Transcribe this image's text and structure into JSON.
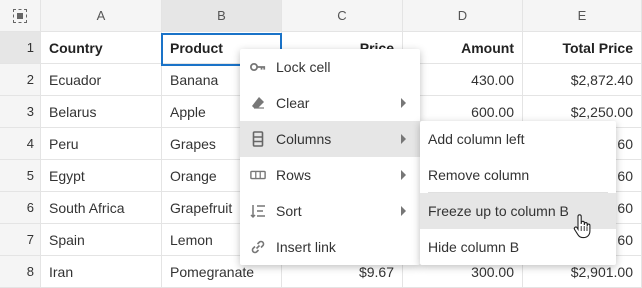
{
  "columns": [
    "A",
    "B",
    "C",
    "D",
    "E"
  ],
  "rows": [
    {
      "n": "1",
      "a": "Country",
      "b": "Product",
      "c": "Price",
      "d": "Amount",
      "e": "Total Price"
    },
    {
      "n": "2",
      "a": "Ecuador",
      "b": "Banana",
      "c": "",
      "d": "430.00",
      "e": "$2,872.40"
    },
    {
      "n": "3",
      "a": "Belarus",
      "b": "Apple",
      "c": "",
      "d": "600.00",
      "e": "$2,250.00"
    },
    {
      "n": "4",
      "a": "Peru",
      "b": "Grapes",
      "c": "",
      "d": "",
      "e": "60"
    },
    {
      "n": "5",
      "a": "Egypt",
      "b": "Orange",
      "c": "",
      "d": "",
      "e": "60"
    },
    {
      "n": "6",
      "a": "South Africa",
      "b": "Grapefruit",
      "c": "",
      "d": "",
      "e": "60"
    },
    {
      "n": "7",
      "a": "Spain",
      "b": "Lemon",
      "c": "",
      "d": "",
      "e": "60"
    },
    {
      "n": "8",
      "a": "Iran",
      "b": "Pomegranate",
      "c": "$9.67",
      "d": "300.00",
      "e": "$2,901.00"
    }
  ],
  "context_menu": {
    "items": [
      {
        "label": "Lock cell",
        "icon": "key-icon"
      },
      {
        "label": "Clear",
        "icon": "eraser-icon"
      },
      {
        "label": "Columns",
        "icon": "columns-icon"
      },
      {
        "label": "Rows",
        "icon": "rows-icon"
      },
      {
        "label": "Sort",
        "icon": "sort-icon"
      },
      {
        "label": "Insert link",
        "icon": "link-icon"
      }
    ]
  },
  "columns_submenu": {
    "items": [
      "Add column left",
      "Remove column",
      "Freeze up to column B",
      "Hide column B"
    ]
  }
}
